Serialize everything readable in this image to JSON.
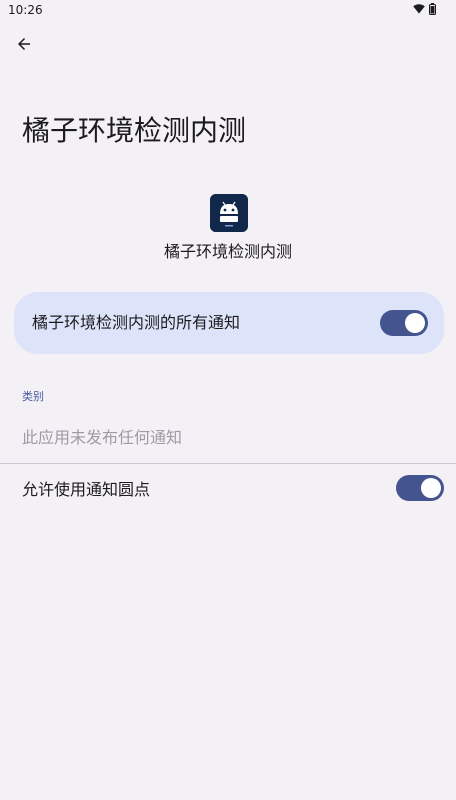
{
  "status_bar": {
    "time": "10:26",
    "icons": [
      "wifi-icon",
      "battery-icon"
    ]
  },
  "navigation": {
    "back_icon": "arrow-back-icon"
  },
  "header": {
    "title": "橘子环境检测内测"
  },
  "app_info": {
    "icon": "android-app-icon",
    "icon_text": "< tax >",
    "name": "橘子环境检测内测"
  },
  "master_toggle": {
    "label": "橘子环境检测内测的所有通知",
    "enabled": true
  },
  "categories": {
    "header": "类别",
    "empty_message": "此应用未发布任何通知"
  },
  "notification_dot": {
    "label": "允许使用通知圆点",
    "enabled": true
  },
  "colors": {
    "background": "#f3f0f6",
    "card": "#dde3f8",
    "switch_track": "#43548f",
    "accent_text": "#4a5aa0"
  }
}
